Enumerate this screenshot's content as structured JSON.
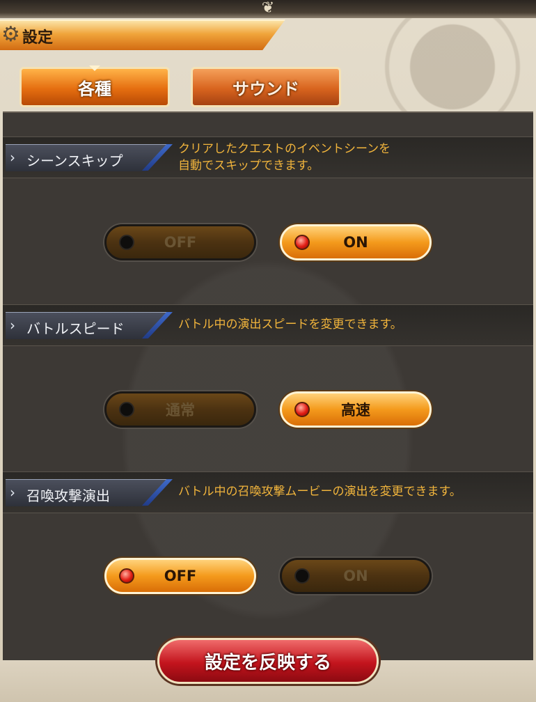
{
  "header": {
    "title": "設定",
    "icon": "gear-icon"
  },
  "tabs": [
    {
      "label": "各種",
      "active": true
    },
    {
      "label": "サウンド",
      "active": false
    }
  ],
  "sections": [
    {
      "label": "シーンスキップ",
      "description_line1": "クリアしたクエストのイベントシーンを",
      "description_line2": "自動でスキップできます。",
      "options": [
        {
          "label": "OFF",
          "selected": false
        },
        {
          "label": "ON",
          "selected": true
        }
      ]
    },
    {
      "label": "バトルスピード",
      "description_line1": "バトル中の演出スピードを変更できます。",
      "description_line2": "",
      "options": [
        {
          "label": "通常",
          "selected": false
        },
        {
          "label": "高速",
          "selected": true
        }
      ]
    },
    {
      "label": "召喚攻撃演出",
      "description_line1": "バトル中の召喚攻撃ムービーの演出を変更できます。",
      "description_line2": "",
      "options": [
        {
          "label": "OFF",
          "selected": true
        },
        {
          "label": "ON",
          "selected": false
        }
      ]
    }
  ],
  "apply_button": {
    "label": "設定を反映する"
  },
  "colors": {
    "accent_orange": "#e56e10",
    "description_text": "#f2b53c",
    "apply_red": "#c3141d",
    "panel_bg": "#3d3935"
  }
}
